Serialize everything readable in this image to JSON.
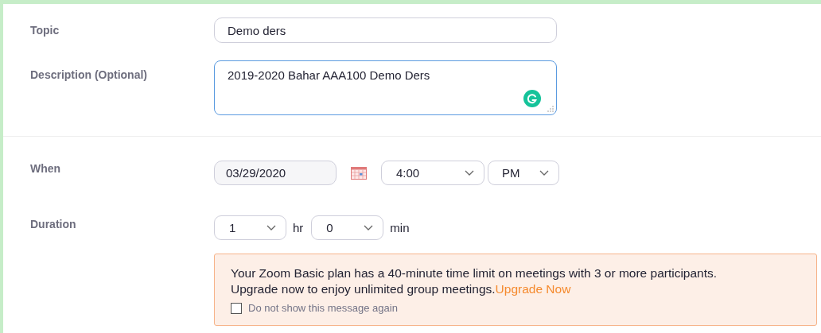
{
  "topic": {
    "label": "Topic",
    "value": "Demo ders"
  },
  "description": {
    "label": "Description (Optional)",
    "value": "2019-2020 Bahar AAA100 Demo Ders"
  },
  "when": {
    "label": "When",
    "date": "03/29/2020",
    "time": "4:00",
    "period": "PM"
  },
  "duration": {
    "label": "Duration",
    "hours": "1",
    "hours_unit": "hr",
    "minutes": "0",
    "minutes_unit": "min"
  },
  "notice": {
    "lines": [
      "Your Zoom Basic plan has a 40-minute time limit on meetings with 3 or more participants.",
      "Upgrade now to enjoy unlimited group meetings."
    ],
    "link": "Upgrade Now",
    "checkbox": {
      "label": "Do not show this message again",
      "checked": false
    }
  }
}
